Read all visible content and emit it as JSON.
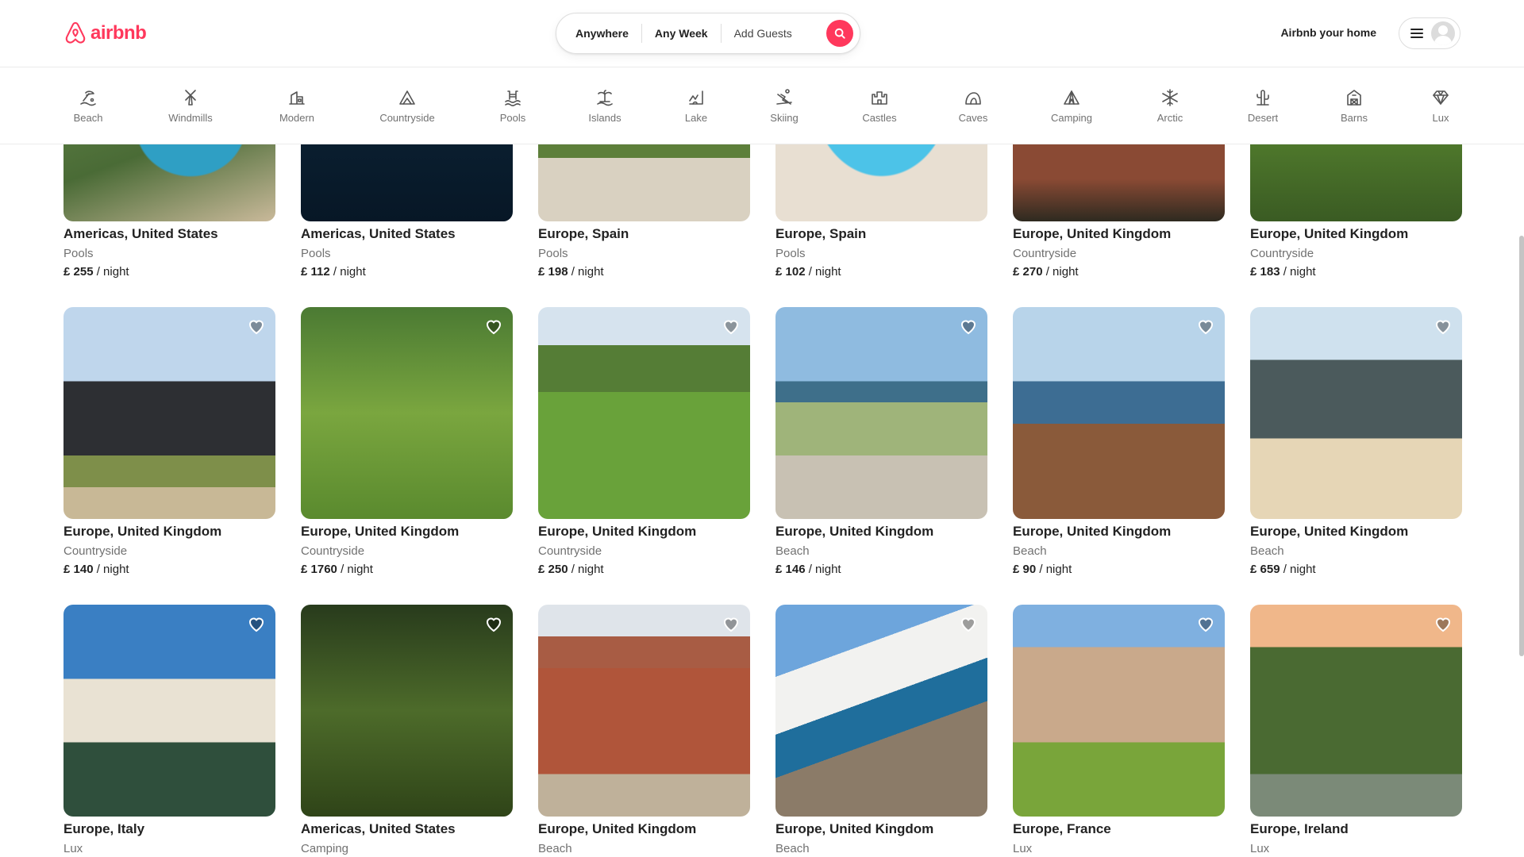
{
  "brand": {
    "name": "airbnb",
    "color": "#ff385c"
  },
  "search": {
    "anywhere": "Anywhere",
    "any_week": "Any Week",
    "add_guests": "Add Guests"
  },
  "header": {
    "host_link": "Airbnb your home"
  },
  "categories": [
    {
      "label": "Beach",
      "icon": "beach-icon"
    },
    {
      "label": "Windmills",
      "icon": "windmill-icon"
    },
    {
      "label": "Modern",
      "icon": "modern-house-icon"
    },
    {
      "label": "Countryside",
      "icon": "countryside-icon"
    },
    {
      "label": "Pools",
      "icon": "pool-icon"
    },
    {
      "label": "Islands",
      "icon": "island-icon"
    },
    {
      "label": "Lake",
      "icon": "lake-icon"
    },
    {
      "label": "Skiing",
      "icon": "skiing-icon"
    },
    {
      "label": "Castles",
      "icon": "castle-icon"
    },
    {
      "label": "Caves",
      "icon": "cave-icon"
    },
    {
      "label": "Camping",
      "icon": "camping-icon"
    },
    {
      "label": "Arctic",
      "icon": "snowflake-icon"
    },
    {
      "label": "Desert",
      "icon": "cactus-icon"
    },
    {
      "label": "Barns",
      "icon": "barn-icon"
    },
    {
      "label": "Lux",
      "icon": "diamond-icon"
    }
  ],
  "listings": [
    {
      "location": "Americas, United States",
      "category": "Pools",
      "price": "£ 255",
      "unit": "/ night"
    },
    {
      "location": "Americas, United States",
      "category": "Pools",
      "price": "£ 112",
      "unit": "/ night"
    },
    {
      "location": "Europe, Spain",
      "category": "Pools",
      "price": "£ 198",
      "unit": "/ night"
    },
    {
      "location": "Europe, Spain",
      "category": "Pools",
      "price": "£ 102",
      "unit": "/ night"
    },
    {
      "location": "Europe, United Kingdom",
      "category": "Countryside",
      "price": "£ 270",
      "unit": "/ night"
    },
    {
      "location": "Europe, United Kingdom",
      "category": "Countryside",
      "price": "£ 183",
      "unit": "/ night"
    },
    {
      "location": "Europe, United Kingdom",
      "category": "Countryside",
      "price": "£ 140",
      "unit": "/ night"
    },
    {
      "location": "Europe, United Kingdom",
      "category": "Countryside",
      "price": "£ 1760",
      "unit": "/ night"
    },
    {
      "location": "Europe, United Kingdom",
      "category": "Countryside",
      "price": "£ 250",
      "unit": "/ night"
    },
    {
      "location": "Europe, United Kingdom",
      "category": "Beach",
      "price": "£ 146",
      "unit": "/ night"
    },
    {
      "location": "Europe, United Kingdom",
      "category": "Beach",
      "price": "£ 90",
      "unit": "/ night"
    },
    {
      "location": "Europe, United Kingdom",
      "category": "Beach",
      "price": "£ 659",
      "unit": "/ night"
    },
    {
      "location": "Europe, Italy",
      "category": "Lux"
    },
    {
      "location": "Americas, United States",
      "category": "Camping"
    },
    {
      "location": "Europe, United Kingdom",
      "category": "Beach"
    },
    {
      "location": "Europe, United Kingdom",
      "category": "Beach"
    },
    {
      "location": "Europe, France",
      "category": "Lux"
    },
    {
      "location": "Europe, Ireland",
      "category": "Lux"
    }
  ]
}
